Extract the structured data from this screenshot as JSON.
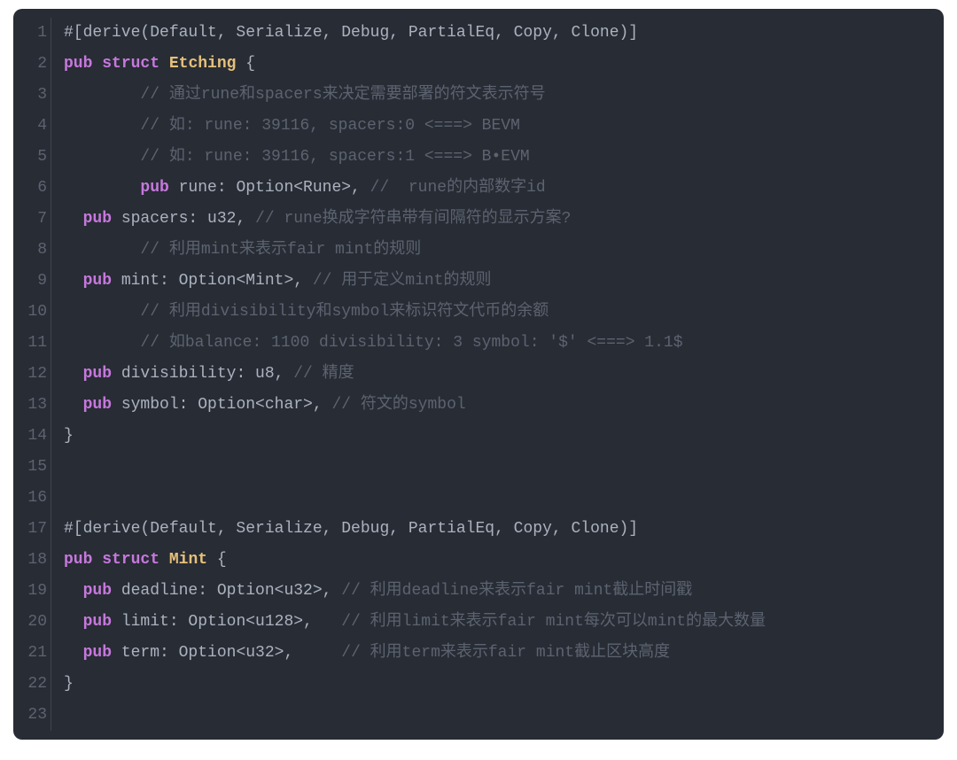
{
  "language": "rust",
  "colors": {
    "background": "#282c34",
    "default": "#abb2bf",
    "gutter": "#5c6370",
    "keyword": "#c678dd",
    "struct_name": "#e5c07b",
    "comment": "#5c6370"
  },
  "lines": [
    {
      "n": "1",
      "tokens": [
        {
          "t": "#[derive(Default, Serialize, Debug, PartialEq, Copy, Clone)]",
          "c": "tok-attr"
        }
      ]
    },
    {
      "n": "2",
      "tokens": [
        {
          "t": "pub",
          "c": "tok-kw"
        },
        {
          "t": " ",
          "c": ""
        },
        {
          "t": "struct",
          "c": "tok-kw"
        },
        {
          "t": " ",
          "c": ""
        },
        {
          "t": "Etching",
          "c": "tok-struct"
        },
        {
          "t": " {",
          "c": "tok-punc"
        }
      ]
    },
    {
      "n": "3",
      "tokens": [
        {
          "t": "        ",
          "c": ""
        },
        {
          "t": "// 通过rune和spacers来决定需要部署的符文表示符号",
          "c": "tok-comment"
        }
      ]
    },
    {
      "n": "4",
      "tokens": [
        {
          "t": "        ",
          "c": ""
        },
        {
          "t": "// 如: rune: 39116, spacers:0 <===> BEVM",
          "c": "tok-comment"
        }
      ]
    },
    {
      "n": "5",
      "tokens": [
        {
          "t": "        ",
          "c": ""
        },
        {
          "t": "// 如: rune: 39116, spacers:1 <===> B•EVM",
          "c": "tok-comment"
        }
      ]
    },
    {
      "n": "6",
      "tokens": [
        {
          "t": "        ",
          "c": ""
        },
        {
          "t": "pub",
          "c": "tok-kw"
        },
        {
          "t": " rune: Option<Rune>, ",
          "c": "tok-field"
        },
        {
          "t": "//  rune的内部数字id",
          "c": "tok-comment"
        }
      ]
    },
    {
      "n": "7",
      "tokens": [
        {
          "t": "  ",
          "c": ""
        },
        {
          "t": "pub",
          "c": "tok-kw"
        },
        {
          "t": " spacers: u32, ",
          "c": "tok-field"
        },
        {
          "t": "// rune换成字符串带有间隔符的显示方案?",
          "c": "tok-comment"
        }
      ]
    },
    {
      "n": "8",
      "tokens": [
        {
          "t": "        ",
          "c": ""
        },
        {
          "t": "// 利用mint来表示fair mint的规则",
          "c": "tok-comment"
        }
      ]
    },
    {
      "n": "9",
      "tokens": [
        {
          "t": "  ",
          "c": ""
        },
        {
          "t": "pub",
          "c": "tok-kw"
        },
        {
          "t": " mint: Option<Mint>, ",
          "c": "tok-field"
        },
        {
          "t": "// 用于定义mint的规则",
          "c": "tok-comment"
        }
      ]
    },
    {
      "n": "10",
      "tokens": [
        {
          "t": "        ",
          "c": ""
        },
        {
          "t": "// 利用divisibility和symbol来标识符文代币的余额",
          "c": "tok-comment"
        }
      ]
    },
    {
      "n": "11",
      "tokens": [
        {
          "t": "        ",
          "c": ""
        },
        {
          "t": "// 如balance: 1100 divisibility: 3 symbol: '$' <===> 1.1$",
          "c": "tok-comment"
        }
      ]
    },
    {
      "n": "12",
      "tokens": [
        {
          "t": "  ",
          "c": ""
        },
        {
          "t": "pub",
          "c": "tok-kw"
        },
        {
          "t": " divisibility: u8, ",
          "c": "tok-field"
        },
        {
          "t": "// 精度",
          "c": "tok-comment"
        }
      ]
    },
    {
      "n": "13",
      "tokens": [
        {
          "t": "  ",
          "c": ""
        },
        {
          "t": "pub",
          "c": "tok-kw"
        },
        {
          "t": " symbol: Option<char>, ",
          "c": "tok-field"
        },
        {
          "t": "// 符文的symbol",
          "c": "tok-comment"
        }
      ]
    },
    {
      "n": "14",
      "tokens": [
        {
          "t": "}",
          "c": "tok-punc"
        }
      ]
    },
    {
      "n": "15",
      "tokens": [
        {
          "t": "",
          "c": ""
        }
      ]
    },
    {
      "n": "16",
      "tokens": [
        {
          "t": "",
          "c": ""
        }
      ]
    },
    {
      "n": "17",
      "tokens": [
        {
          "t": "#[derive(Default, Serialize, Debug, PartialEq, Copy, Clone)]",
          "c": "tok-attr"
        }
      ]
    },
    {
      "n": "18",
      "tokens": [
        {
          "t": "pub",
          "c": "tok-kw"
        },
        {
          "t": " ",
          "c": ""
        },
        {
          "t": "struct",
          "c": "tok-kw"
        },
        {
          "t": " ",
          "c": ""
        },
        {
          "t": "Mint",
          "c": "tok-struct"
        },
        {
          "t": " {",
          "c": "tok-punc"
        }
      ]
    },
    {
      "n": "19",
      "tokens": [
        {
          "t": "  ",
          "c": ""
        },
        {
          "t": "pub",
          "c": "tok-kw"
        },
        {
          "t": " deadline: Option<u32>, ",
          "c": "tok-field"
        },
        {
          "t": "// 利用deadline来表示fair mint截止时间戳",
          "c": "tok-comment"
        }
      ]
    },
    {
      "n": "20",
      "tokens": [
        {
          "t": "  ",
          "c": ""
        },
        {
          "t": "pub",
          "c": "tok-kw"
        },
        {
          "t": " limit: Option<u128>,   ",
          "c": "tok-field"
        },
        {
          "t": "// 利用limit来表示fair mint每次可以mint的最大数量",
          "c": "tok-comment"
        }
      ]
    },
    {
      "n": "21",
      "tokens": [
        {
          "t": "  ",
          "c": ""
        },
        {
          "t": "pub",
          "c": "tok-kw"
        },
        {
          "t": " term: Option<u32>,     ",
          "c": "tok-field"
        },
        {
          "t": "// 利用term来表示fair mint截止区块高度",
          "c": "tok-comment"
        }
      ]
    },
    {
      "n": "22",
      "tokens": [
        {
          "t": "}",
          "c": "tok-punc"
        }
      ]
    },
    {
      "n": "23",
      "tokens": [
        {
          "t": "",
          "c": ""
        }
      ]
    }
  ]
}
